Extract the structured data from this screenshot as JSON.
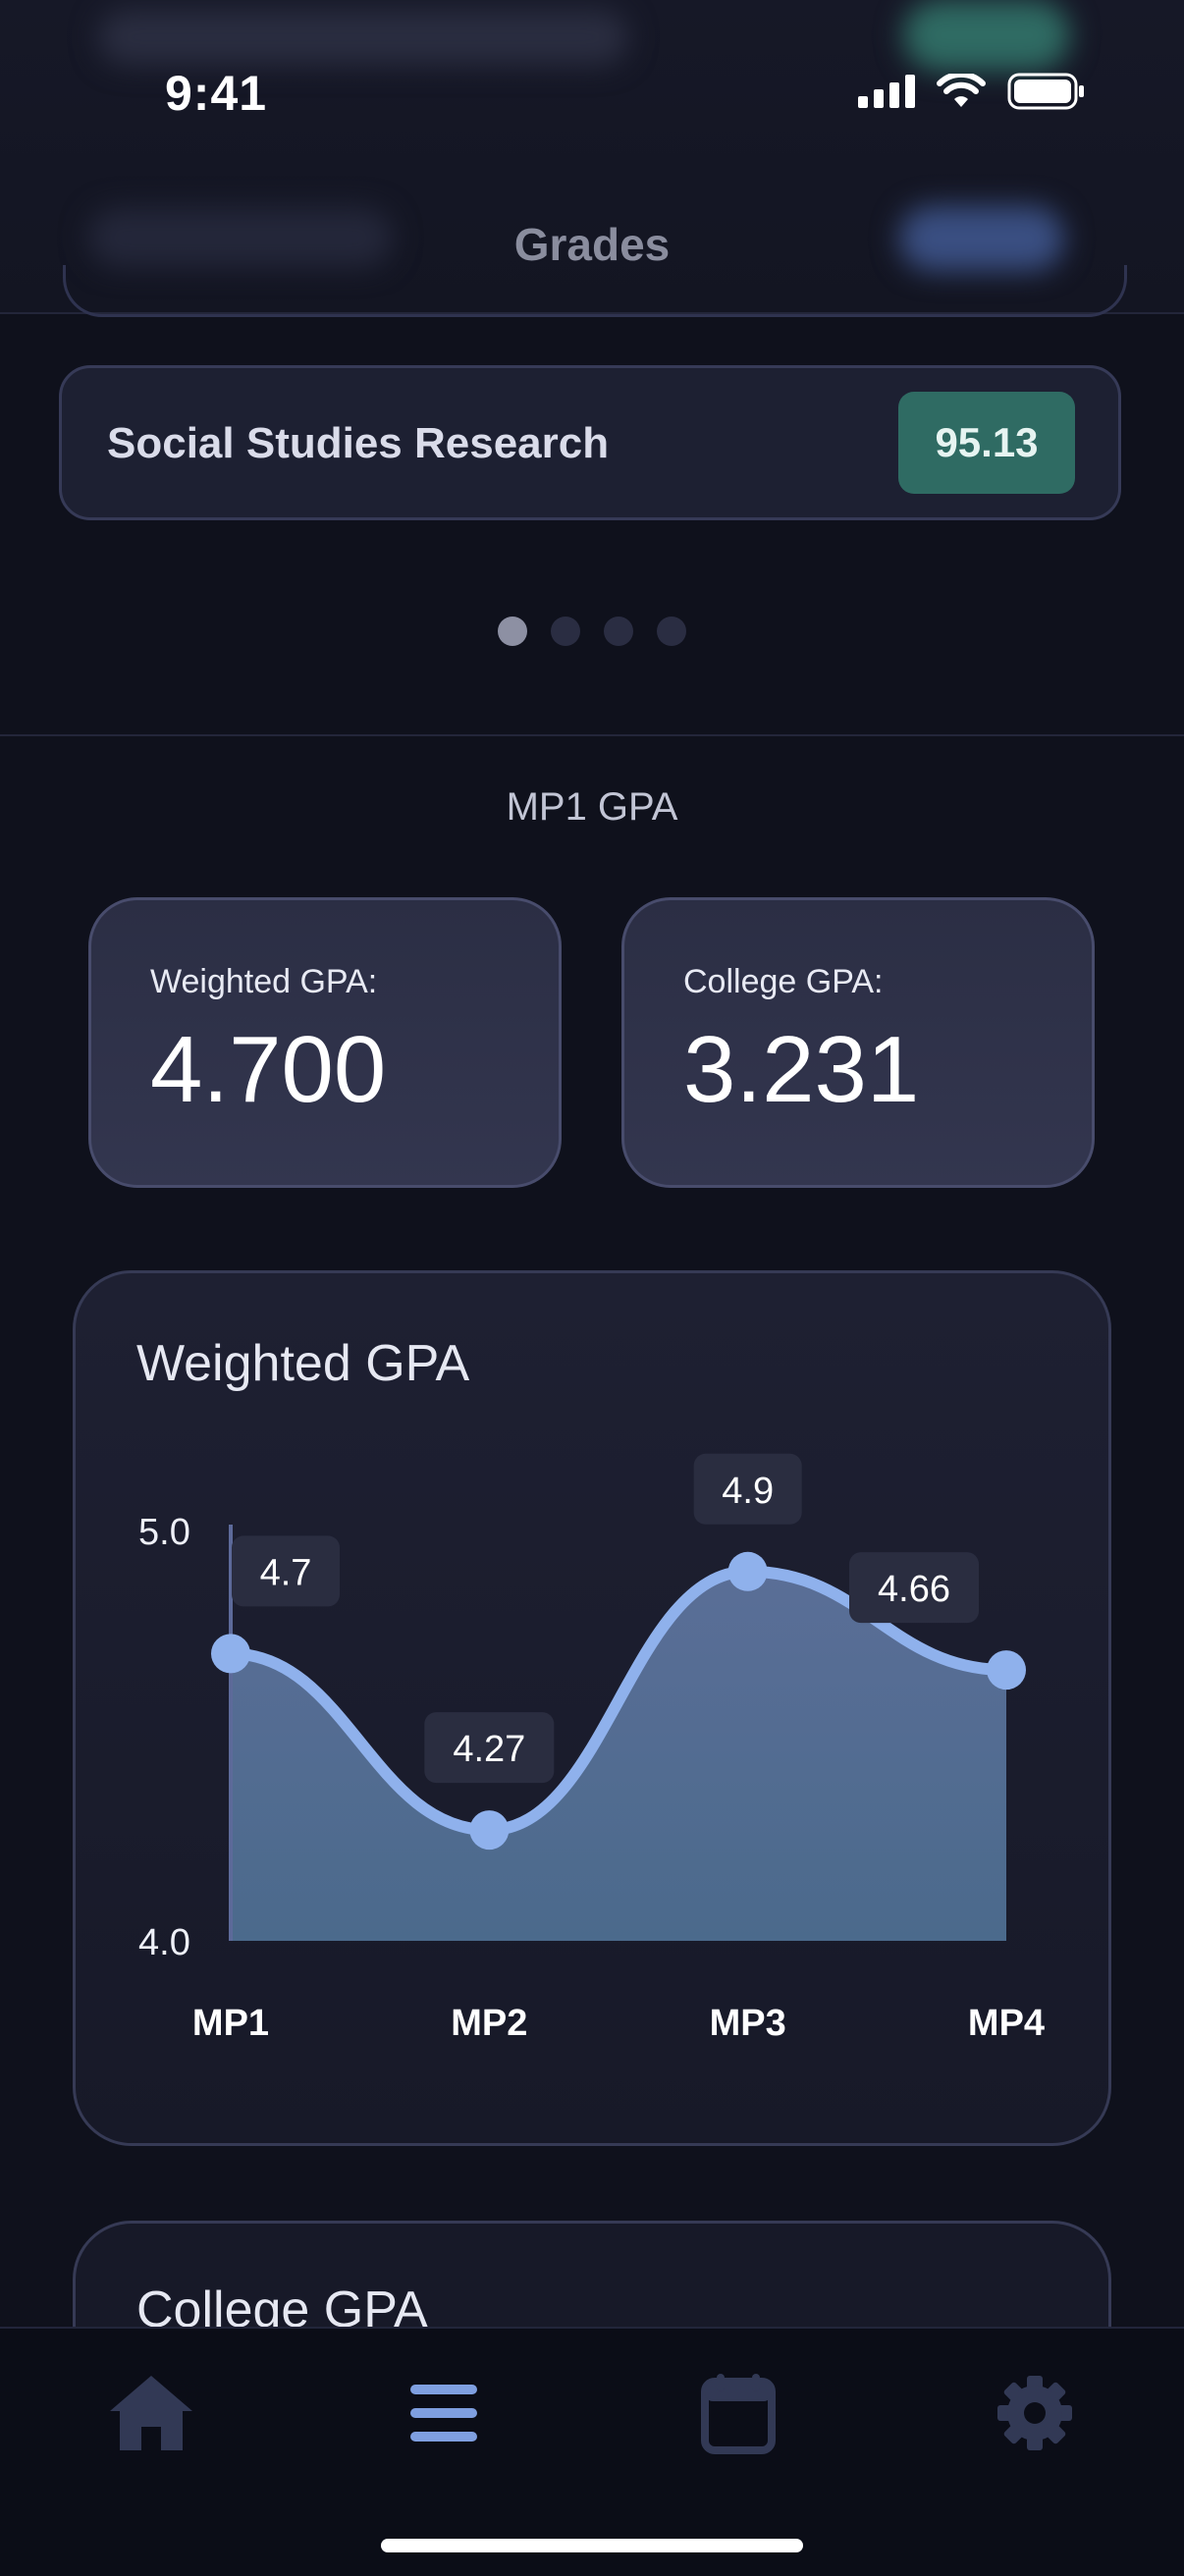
{
  "status_bar": {
    "time": "9:41"
  },
  "header": {
    "title": "Grades"
  },
  "course": {
    "name": "Social Studies Research",
    "grade": "95.13"
  },
  "pager": {
    "count": 4,
    "active": 0
  },
  "gpa_section": {
    "title": "MP1 GPA",
    "weighted": {
      "label": "Weighted GPA:",
      "value": "4.700"
    },
    "college": {
      "label": "College GPA:",
      "value": "3.231"
    }
  },
  "chart_data": {
    "type": "area",
    "title": "Weighted GPA",
    "categories": [
      "MP1",
      "MP2",
      "MP3",
      "MP4"
    ],
    "values": [
      4.7,
      4.27,
      4.9,
      4.66
    ],
    "value_labels": [
      "4.7",
      "4.27",
      "4.9",
      "4.66"
    ],
    "y_ticks": [
      "5.0",
      "4.0"
    ],
    "ylim": [
      4.0,
      5.0
    ],
    "line_color": "#8fb1ec",
    "fill_color": "#52698f"
  },
  "college_chart": {
    "title": "College GPA"
  },
  "tabs": [
    {
      "name": "home-icon"
    },
    {
      "name": "list-icon"
    },
    {
      "name": "calendar-icon"
    },
    {
      "name": "gear-icon"
    }
  ],
  "colors": {
    "background": "#0f111c",
    "accent": "#7f9fe0",
    "badge": "#2f6b63",
    "tab_inactive": "#323955"
  }
}
